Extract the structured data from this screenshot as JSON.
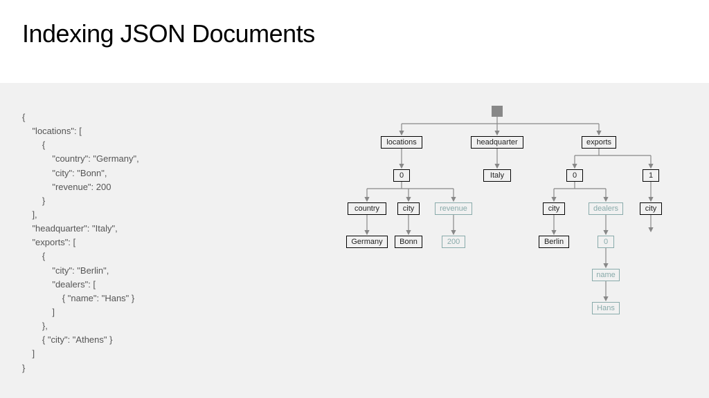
{
  "title": "Indexing JSON Documents",
  "json_text": "{\n    \"locations\": [\n        {\n            \"country\": \"Germany\",\n            \"city\": \"Bonn\",\n            \"revenue\": 200\n        }\n    ],\n    \"headquarter\": \"Italy\",\n    \"exports\": [\n        {\n            \"city\": \"Berlin\",\n            \"dealers\": [\n                { \"name\": \"Hans\" }\n            ]\n        },\n        { \"city\": \"Athens\" }\n    ]\n}",
  "nodes": {
    "locations": "locations",
    "headquarter": "headquarter",
    "exports": "exports",
    "zero_a": "0",
    "italy": "Italy",
    "zero_b": "0",
    "one": "1",
    "country": "country",
    "city_a": "city",
    "revenue": "revenue",
    "city_b": "city",
    "dealers": "dealers",
    "city_c": "city",
    "germany": "Germany",
    "bonn": "Bonn",
    "v200": "200",
    "berlin": "Berlin",
    "zero_c": "0",
    "name": "name",
    "hans": "Hans"
  }
}
